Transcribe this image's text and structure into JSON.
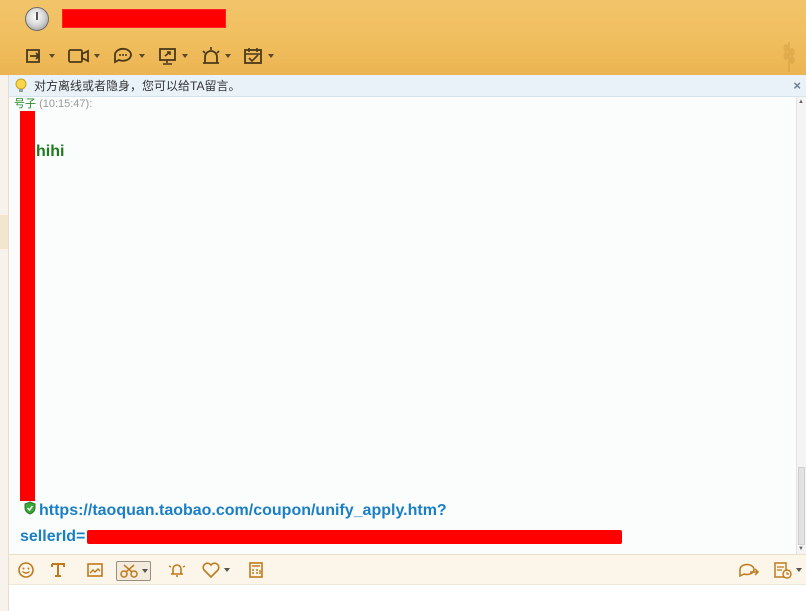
{
  "window": {
    "contact_name_redacted": true
  },
  "toolbar": {
    "items": [
      {
        "name": "send-file",
        "icon": "file-transfer-icon"
      },
      {
        "name": "video",
        "icon": "video-camera-icon"
      },
      {
        "name": "chat",
        "icon": "chat-bubble-icon"
      },
      {
        "name": "screen",
        "icon": "screen-share-icon"
      },
      {
        "name": "alert",
        "icon": "alarm-light-icon"
      },
      {
        "name": "calendar",
        "icon": "calendar-icon"
      }
    ]
  },
  "notice": {
    "text": "对方离线或者隐身，您可以给TA留言。",
    "close": "×"
  },
  "chat": {
    "sender_name": "号子",
    "sender_time": "(10:15:47):",
    "message1": "hihi",
    "link_line1": "https://taoquan.taobao.com/coupon/unify_apply.htm?",
    "link_line2": "sellerId="
  },
  "inputbar": {
    "icons": [
      "emoji-icon",
      "font-icon",
      "image-icon",
      "scissors-icon",
      "bell-icon",
      "heart-icon",
      "calculator-icon",
      "share-icon",
      "history-icon"
    ]
  },
  "colors": {
    "header": "#f0be5e",
    "link": "#1a7fc4",
    "message": "#1f7a1f",
    "redaction": "#ff0000"
  }
}
